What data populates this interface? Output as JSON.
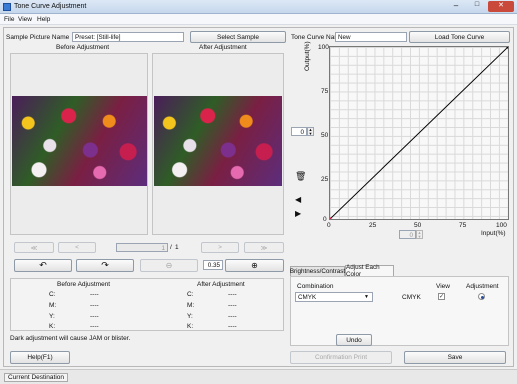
{
  "window": {
    "title": "Tone Curve Adjustment"
  },
  "menu": [
    "File",
    "View",
    "Help"
  ],
  "sample_picture": {
    "label": "Sample Picture Name",
    "value": "Preset: [Still-life]",
    "select_button": "Select Sample"
  },
  "tone_curve": {
    "label": "Tone Curve Name",
    "value": "New",
    "load_button": "Load Tone Curve"
  },
  "preview": {
    "before_label": "Before Adjustment",
    "after_label": "After Adjustment"
  },
  "pager": {
    "first": "≪",
    "prev": "<",
    "page": "1",
    "sep": "/",
    "total": "1",
    "next": ">",
    "last": "≫"
  },
  "zoom": {
    "value": "0.35"
  },
  "values_table": {
    "before_title": "Before Adjustment",
    "after_title": "After Adjustment",
    "rows": [
      {
        "label": "C:",
        "before": "----",
        "after": "----"
      },
      {
        "label": "M:",
        "before": "----",
        "after": "----"
      },
      {
        "label": "Y:",
        "before": "----",
        "after": "----"
      },
      {
        "label": "K:",
        "before": "----",
        "after": "----"
      }
    ]
  },
  "warning": "Dark adjustment will cause JAM or blister.",
  "graph": {
    "y_label": "Output(%)",
    "x_label": "Input(%)",
    "y_ticks": [
      "100",
      "75",
      "50",
      "25",
      "0"
    ],
    "x_ticks": [
      "0",
      "25",
      "50",
      "75",
      "100"
    ],
    "output_spin": "0",
    "input_spin": "0"
  },
  "chart_data": {
    "type": "line",
    "title": "",
    "xlabel": "Input(%)",
    "ylabel": "Output(%)",
    "xlim": [
      0,
      100
    ],
    "ylim": [
      0,
      100
    ],
    "grid": true,
    "series": [
      {
        "x": [
          0,
          100
        ],
        "y": [
          0,
          100
        ]
      }
    ]
  },
  "tabs": [
    "Brightness/Contrast",
    "Adjust Each Color"
  ],
  "adjust": {
    "combination_label": "Combination",
    "combination_value": "CMYK",
    "row_label": "CMYK",
    "view_label": "View",
    "adjustment_label": "Adjustment",
    "undo_button": "Undo"
  },
  "buttons": {
    "help": "Help(F1)",
    "confirmation_print": "Confirmation Print",
    "save": "Save"
  },
  "status": {
    "destination": "Current Destination"
  },
  "colors": {
    "title_bar": "#c6d7ec",
    "curve": "#000000",
    "curve_start": "#d0103a"
  }
}
